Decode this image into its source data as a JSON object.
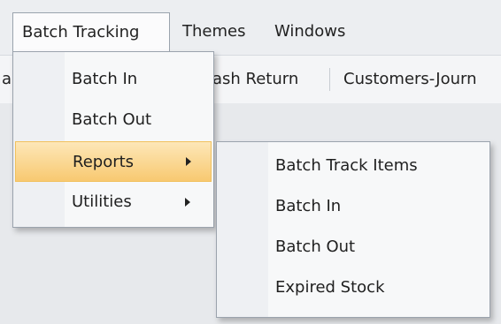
{
  "menubar": {
    "items": [
      {
        "label": "Batch Tracking"
      },
      {
        "label": "Themes"
      },
      {
        "label": "Windows"
      }
    ]
  },
  "toolbar": {
    "left_fragment": "a",
    "cash_return": "ash Return",
    "customers_journal": "Customers-Journ"
  },
  "batch_menu": {
    "items": [
      {
        "label": "Batch In"
      },
      {
        "label": "Batch Out"
      },
      {
        "label": "Reports",
        "submenu_icon": "chevron-right-icon",
        "highlighted": true
      },
      {
        "label": "Utilities",
        "submenu_icon": "chevron-right-icon"
      }
    ]
  },
  "reports_submenu": {
    "items": [
      {
        "label": "Batch Track Items"
      },
      {
        "label": "Batch In"
      },
      {
        "label": "Batch Out"
      },
      {
        "label": "Expired Stock"
      }
    ]
  },
  "colors": {
    "highlight": "#f8c971",
    "menubar_bg": "#eceef1",
    "menu_bg": "#f7f8f9"
  }
}
